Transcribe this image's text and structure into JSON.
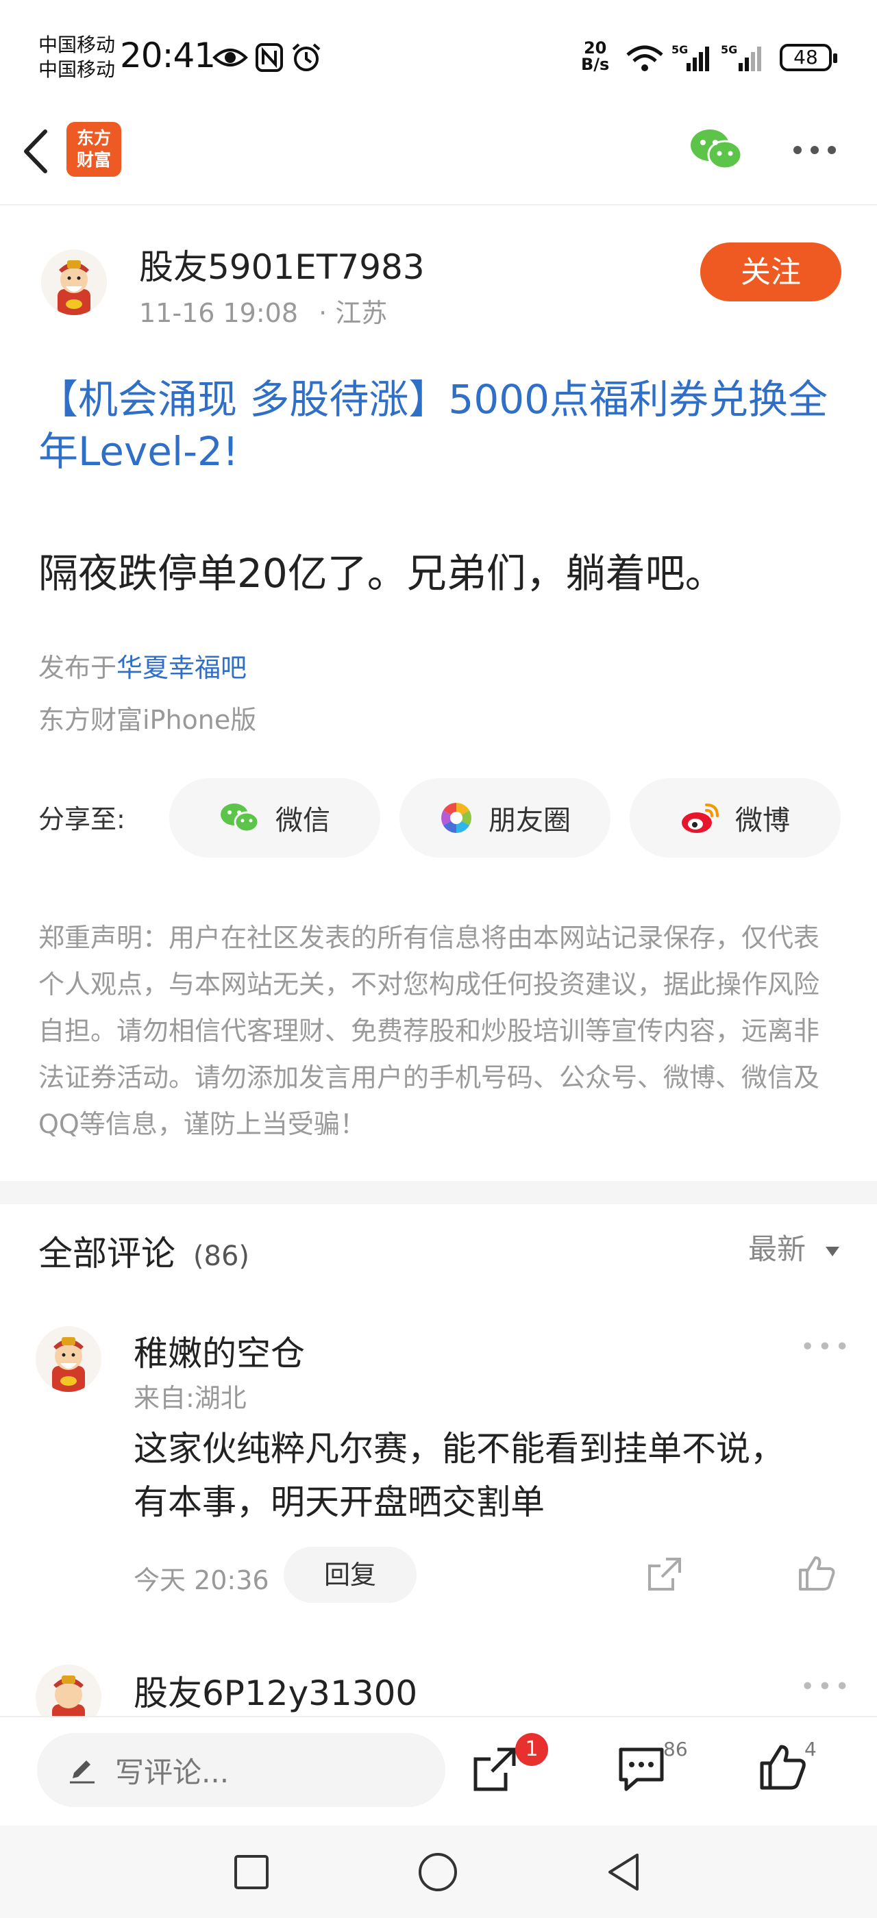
{
  "status_bar": {
    "carrier_1": "中国移动",
    "carrier_2": "中国移动",
    "time": "20:41",
    "net_speed_value": "20",
    "net_speed_unit": "B/s",
    "battery": "48"
  },
  "nav": {
    "logo_line1": "东方",
    "logo_line2": "财富"
  },
  "post": {
    "author": "股友5901ET7983",
    "date": "11-16 19:08",
    "location": "· 江苏",
    "follow_label": "关注",
    "title": "【机会涌现 多股待涨】5000点福利券兑换全年Level-2!",
    "body": "隔夜跌停单20亿了。兄弟们，躺着吧。",
    "published_prefix": "发布于",
    "published_forum": "华夏幸福吧",
    "client": "东方财富iPhone版"
  },
  "share": {
    "label": "分享至:",
    "wechat": "微信",
    "moments": "朋友圈",
    "weibo": "微博"
  },
  "disclaimer": "郑重声明：用户在社区发表的所有信息将由本网站记录保存，仅代表个人观点，与本网站无关，不对您构成任何投资建议，据此操作风险自担。请勿相信代客理财、免费荐股和炒股培训等宣传内容，远离非法证券活动。请勿添加发言用户的手机号码、公众号、微博、微信及QQ等信息，谨防上当受骗！",
  "comments": {
    "title": "全部评论",
    "count": "(86)",
    "sort_label": "最新",
    "items": [
      {
        "name": "稚嫩的空仓",
        "location": "来自:湖北",
        "line1": "这家伙纯粹凡尔赛，能不能看到挂单不说，",
        "line2": "有本事，明天开盘晒交割单",
        "time": "今天 20:36",
        "reply_label": "回复"
      },
      {
        "name": "股友6P12y31300"
      }
    ]
  },
  "toolbar": {
    "placeholder": "写评论...",
    "share_badge": "1",
    "comment_count": "86",
    "like_count": "4"
  }
}
